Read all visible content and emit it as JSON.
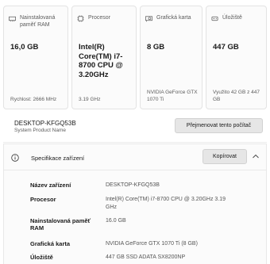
{
  "cards": [
    {
      "icon": "ram-icon",
      "label": "Nainstalovaná paměť RAM",
      "value": "16,0 GB",
      "footer": "Rychlost: 2666 MHz"
    },
    {
      "icon": "processor-icon",
      "label": "Procesor",
      "value": "Intel(R) Core(TM) i7-8700 CPU @ 3.20GHz",
      "footer": "3.19 GHz"
    },
    {
      "icon": "graphics-card-icon",
      "label": "Grafická karta",
      "value": "8 GB",
      "footer": "NVIDIA GeForce GTX 1070 Ti"
    },
    {
      "icon": "storage-icon",
      "label": "Úložiště",
      "value": "447 GB",
      "footer": "Využito 42 GB z 447 GB"
    }
  ],
  "device": {
    "name": "DESKTOP-KFGQ53B",
    "subtitle": "System Product Name",
    "rename_label": "Přejmenovat tento počítač"
  },
  "specs": {
    "title": "Specifikace zařízení",
    "copy_label": "Kopírovat",
    "rows": [
      {
        "key": "Název zařízení",
        "value": "DESKTOP-KFGQ53B"
      },
      {
        "key": "Procesor",
        "value": "Intel(R) Core(TM) i7-8700 CPU @ 3.20GHz   3.19 GHz"
      },
      {
        "key": "Nainstalovaná paměť RAM",
        "value": "16.0 GB"
      },
      {
        "key": "Grafická karta",
        "value": "NVIDIA GeForce GTX 1070 Ti (8 GB)"
      },
      {
        "key": "Úložiště",
        "value": "447 GB SSD ADATA SX8200NP"
      }
    ]
  }
}
